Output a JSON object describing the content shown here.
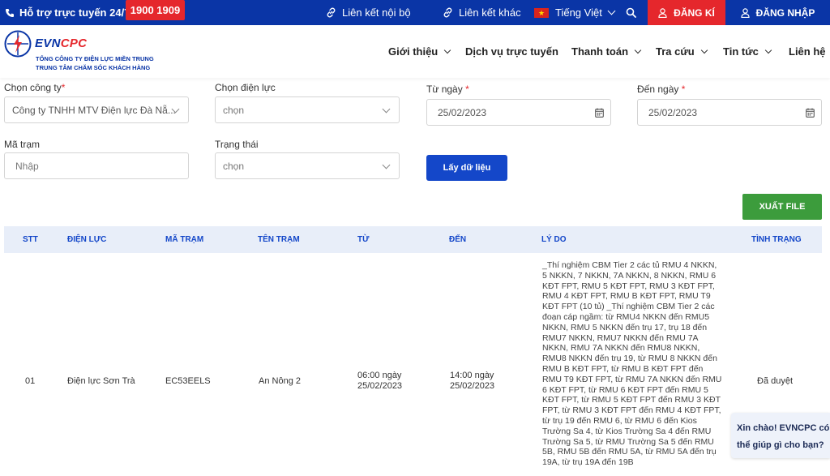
{
  "topbar": {
    "support_text": "Hỗ trợ trực tuyến 24/7:",
    "hotline": "1900 1909",
    "internal_link": "Liên kết nội bộ",
    "other_link": "Liên kết khác",
    "language": "Tiếng Việt",
    "register": "ĐĂNG KÍ",
    "login": "ĐĂNG NHẬP"
  },
  "header": {
    "brand_evn": "EVN",
    "brand_cpc": "CPC",
    "sub1": "TỔNG CÔNG TY ĐIỆN LỰC MIỀN TRUNG",
    "sub2": "TRUNG TÂM CHĂM SÓC KHÁCH HÀNG",
    "nav": [
      "Giới thiệu",
      "Dịch vụ trực tuyến",
      "Thanh toán",
      "Tra cứu",
      "Tin tức",
      "Liên hệ"
    ]
  },
  "form": {
    "company_label": "Chọn công ty",
    "company_value": "Công ty TNHH MTV Điện lực Đà Nẵ...",
    "power_label": "Chọn điện lực",
    "power_value": "chọn",
    "from_label": "Từ ngày",
    "from_value": "25/02/2023",
    "to_label": "Đến ngày",
    "to_value": "25/02/2023",
    "station_label": "Mã trạm",
    "station_placeholder": "Nhập",
    "status_label": "Trạng thái",
    "status_value": "chọn",
    "fetch_button": "Lấy dữ liệu",
    "export_button": "XUẤT FILE",
    "required_mark": "*"
  },
  "table": {
    "headers": [
      "STT",
      "ĐIỆN LỰC",
      "MÃ TRẠM",
      "TÊN TRẠM",
      "TỪ",
      "ĐẾN",
      "LÝ DO",
      "TÌNH TRẠNG"
    ],
    "row": {
      "stt": "01",
      "power": "Điện lực Sơn Trà",
      "code": "EC53EELS",
      "name": "An Nông 2",
      "from_time": "06:00 ngày",
      "from_date": "25/02/2023",
      "to_time": "14:00 ngày",
      "to_date": "25/02/2023",
      "reason": "_Thí nghiệm CBM Tier 2 các tủ RMU 4 NKKN, 5 NKKN, 7 NKKN, 7A NKKN, 8 NKKN, RMU 6 KĐT FPT, RMU 5 KĐT FPT, RMU 3 KĐT FPT, RMU 4 KĐT FPT, RMU B KĐT FPT, RMU T9 KĐT FPT (10 tủ) _Thí nghiệm CBM Tier 2 các đoạn cáp ngầm: từ RMU4 NKKN đến RMU5 NKKN, RMU 5 NKKN đến trụ 17, trụ 18 đến RMU7 NKKN, RMU7 NKKN đến RMU 7A NKKN, RMU 7A NKKN đến RMU8 NKKN, RMU8 NKKN đến trụ 19, từ RMU 8 NKKN đến RMU B KĐT FPT, từ RMU B KĐT FPT đến RMU T9 KĐT FPT, từ RMU 7A NKKN đến RMU 6 KĐT FPT, từ RMU 6 KĐT FPT đến RMU 5 KĐT FPT, từ RMU 5 KĐT FPT đến RMU 3 KĐT FPT, từ RMU 3 KĐT FPT đến RMU 4 KĐT FPT, từ trụ 19 đến RMU 6, từ RMU 6 đến Kios Trường Sa 4, từ Kios Trường Sa 4 đến RMU Trường Sa 5, từ RMU Trường Sa 5 đến RMU 5B, RMU 5B đến RMU 5A, từ RMU 5A đến trụ 19A, từ trụ 19A đến 19B",
      "status": "Đã duyệt"
    }
  },
  "chat": {
    "line1": "Xin chào! EVNCPC có",
    "line2": "thể giúp gì cho bạn?"
  },
  "colors": {
    "primary": "#0a35a6",
    "accent_red": "#e5272c",
    "button_blue": "#1447c9",
    "export_green": "#3c9c3c",
    "table_header_bg": "#e8eef9"
  }
}
